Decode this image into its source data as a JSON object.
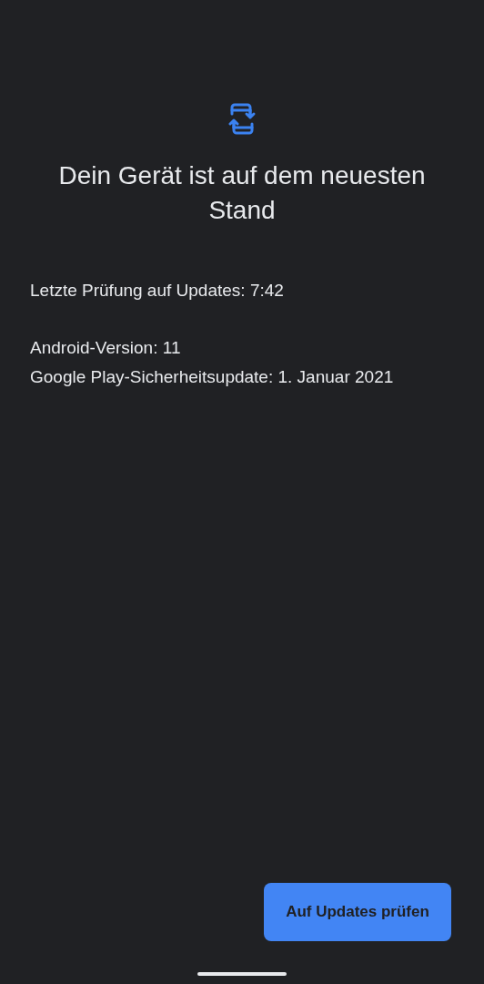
{
  "title": "Dein Gerät ist auf dem neuesten Stand",
  "last_check": "Letzte Prüfung auf Updates: 7:42",
  "info_lines": [
    "Android-Version: 11",
    "Google Play-Sicherheitsupdate: 1. Januar 2021"
  ],
  "button": "Auf Updates prüfen"
}
